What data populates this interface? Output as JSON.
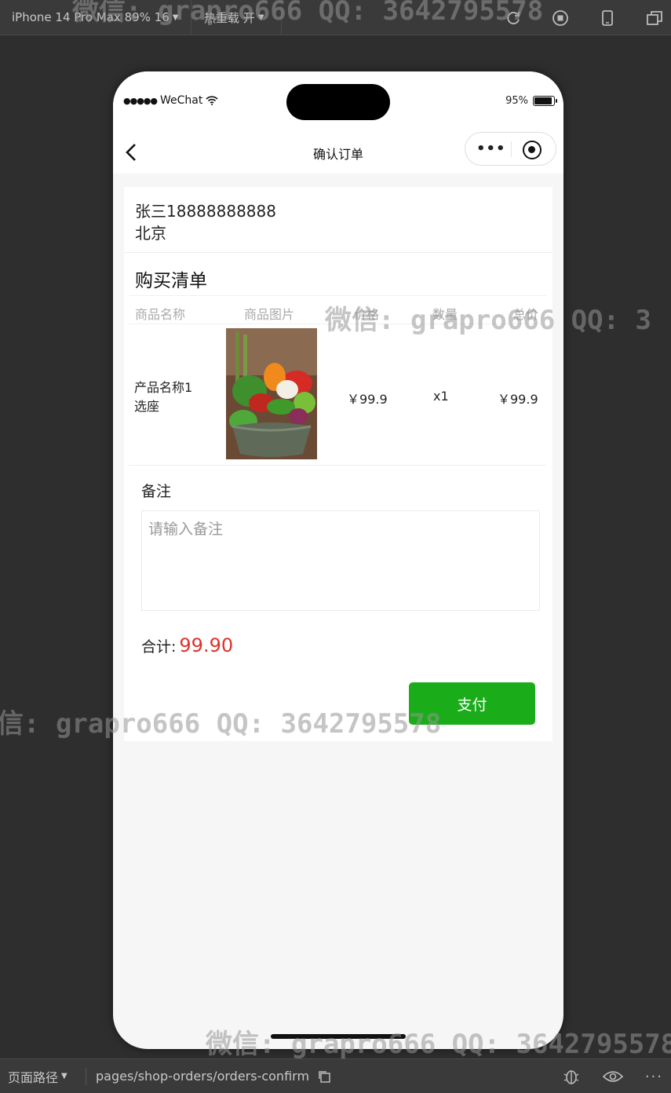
{
  "topbar": {
    "device": "iPhone 14 Pro Max 89% 16",
    "hot_reload": "热重载 开"
  },
  "status_bar": {
    "carrier": "WeChat",
    "battery": "95%"
  },
  "navbar": {
    "title": "确认订单"
  },
  "address": {
    "line1": "张三18888888888",
    "line2": "北京"
  },
  "list": {
    "title": "购买清单",
    "headers": [
      "商品名称",
      "商品图片",
      "价格",
      "数量",
      "总价"
    ],
    "items": [
      {
        "name_line1": "产品名称1",
        "name_line2": "选座",
        "price": "￥99.9",
        "qty": "x1",
        "total": "￥99.9"
      }
    ]
  },
  "note": {
    "label": "备注",
    "placeholder": "请输入备注"
  },
  "summary": {
    "total_label": "合计:",
    "total_value": "99.90",
    "pay_label": "支付"
  },
  "bottombar": {
    "path_label": "页面路径",
    "path": "pages/shop-orders/orders-confirm"
  },
  "watermark": {
    "text1": "微信: grapro666 QQ: 3642795578",
    "text2": "信: grapro666 QQ: 3642795578",
    "text3": "微信: grapro666 QQ: 3642795578",
    "text4": "微信: grapro666 QQ: 3"
  },
  "colors": {
    "accent_green": "#1aad19",
    "price_red": "#e0302a"
  }
}
